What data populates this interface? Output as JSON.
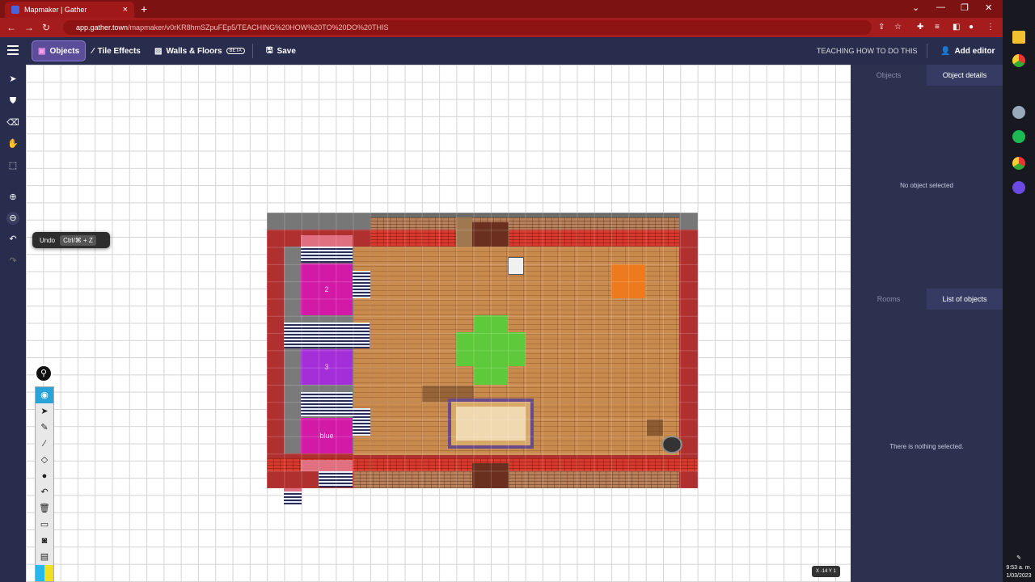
{
  "browser": {
    "tab_title": "Mapmaker | Gather",
    "url_host": "app.gather.town",
    "url_path": "/mapmaker/v0rKR8hmSZpuFEp5/TEACHING%20HOW%20TO%20DO%20THIS",
    "tab_close": "×",
    "new_tab": "+"
  },
  "toolbar": {
    "objects": "Objects",
    "tile_effects": "Tile Effects",
    "walls_floors": "Walls & Floors",
    "beta": "BETA",
    "save": "Save",
    "map_name": "TEACHING HOW TO DO THIS",
    "add_editor": "Add editor"
  },
  "tooltip": {
    "label": "Undo",
    "shortcut": "Ctrl/⌘ + Z"
  },
  "map": {
    "room_labels": [
      "2",
      "3",
      "blue"
    ]
  },
  "coords": "X -14  Y 1",
  "right_panel": {
    "tab_objects": "Objects",
    "tab_object_details": "Object details",
    "no_object": "No object selected",
    "tab_rooms": "Rooms",
    "tab_list": "List of objects",
    "nothing": "There is nothing selected."
  },
  "os": {
    "time": "9:53 a. m.",
    "date": "1/03/2023"
  },
  "colors": {
    "accent": "#5c4d9a",
    "toolbar": "#282d4e",
    "chrome": "#a51c1c"
  }
}
